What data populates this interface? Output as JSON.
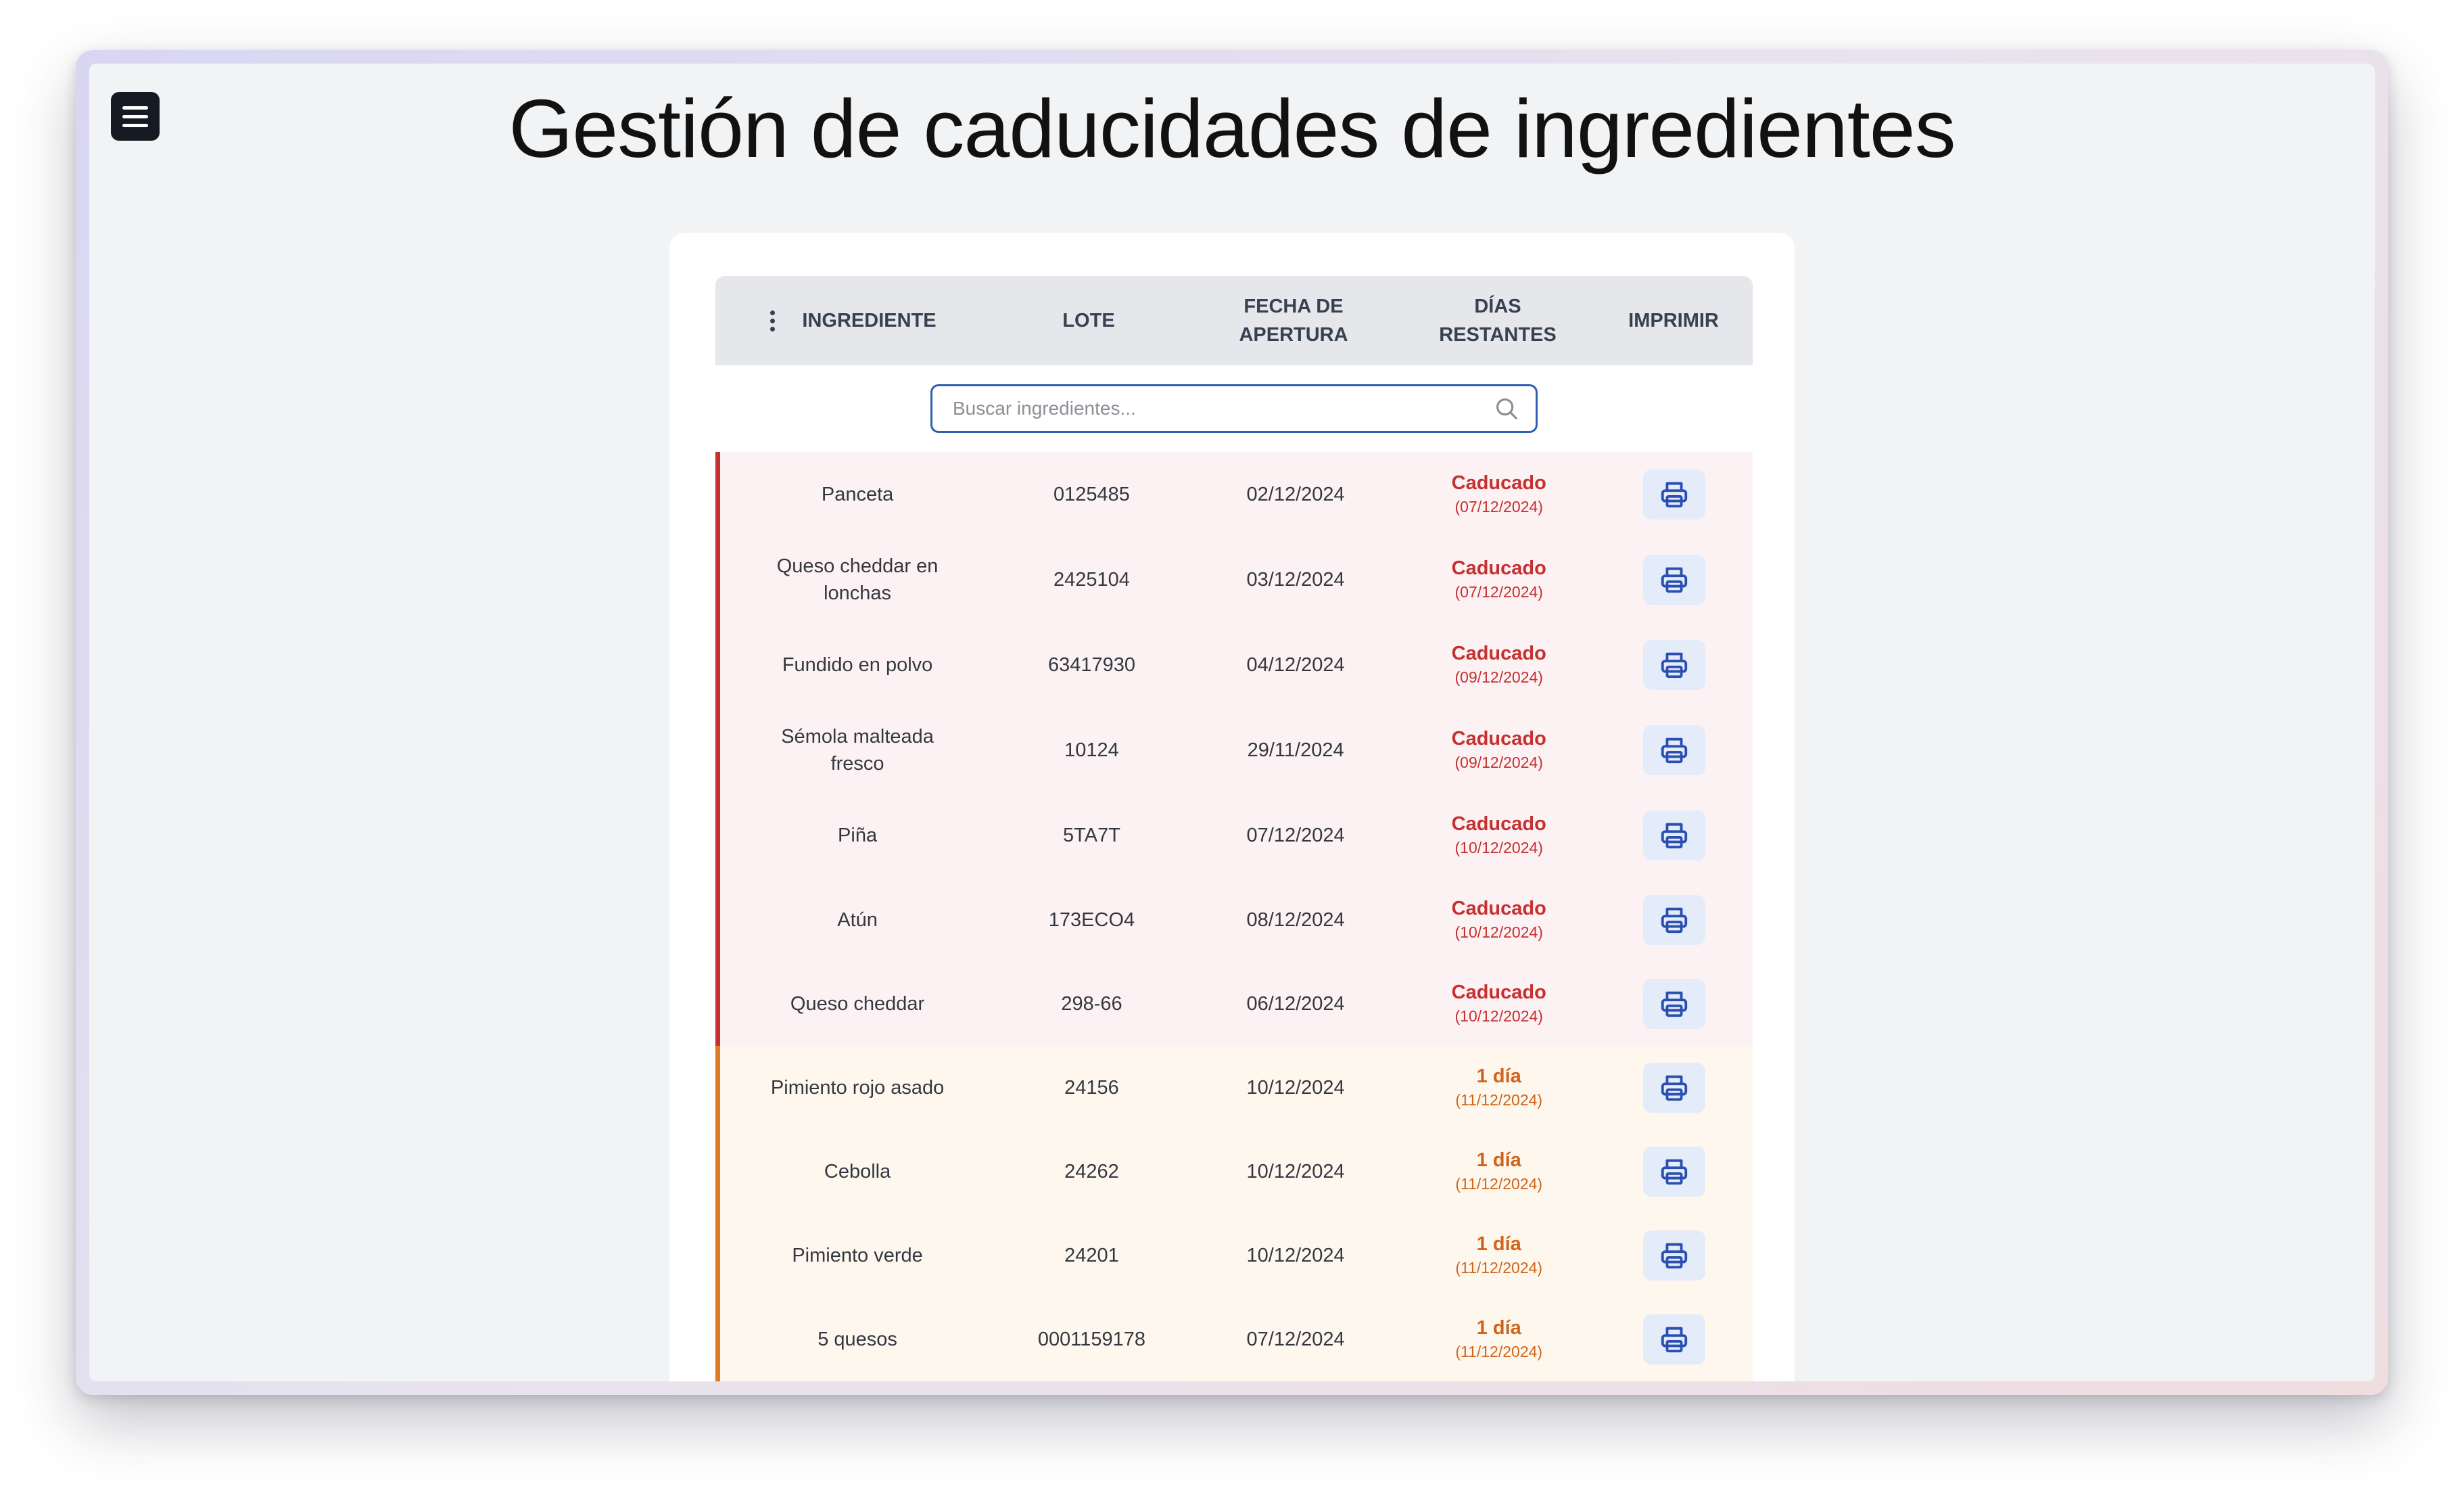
{
  "header": {
    "title": "Gestión de caducidades de ingredientes"
  },
  "table": {
    "columns": {
      "ingrediente": "INGREDIENTE",
      "lote": "LOTE",
      "fecha_l1": "FECHA DE",
      "fecha_l2": "APERTURA",
      "dias_l1": "DÍAS",
      "dias_l2": "RESTANTES",
      "imprimir": "IMPRIMIR"
    },
    "search": {
      "placeholder": "Buscar ingredientes...",
      "value": ""
    },
    "rows": [
      {
        "name_l1": "Panceta",
        "name_l2": "",
        "lote": "0125485",
        "fecha": "02/12/2024",
        "status": "Caducado",
        "date": "(07/12/2024)",
        "level": "expired"
      },
      {
        "name_l1": "Queso cheddar en",
        "name_l2": "lonchas",
        "lote": "2425104",
        "fecha": "03/12/2024",
        "status": "Caducado",
        "date": "(07/12/2024)",
        "level": "expired"
      },
      {
        "name_l1": "Fundido en polvo",
        "name_l2": "",
        "lote": "63417930",
        "fecha": "04/12/2024",
        "status": "Caducado",
        "date": "(09/12/2024)",
        "level": "expired"
      },
      {
        "name_l1": "Sémola malteada",
        "name_l2": "fresco",
        "lote": "10124",
        "fecha": "29/11/2024",
        "status": "Caducado",
        "date": "(09/12/2024)",
        "level": "expired"
      },
      {
        "name_l1": "Piña",
        "name_l2": "",
        "lote": "5TA7T",
        "fecha": "07/12/2024",
        "status": "Caducado",
        "date": "(10/12/2024)",
        "level": "expired"
      },
      {
        "name_l1": "Atún",
        "name_l2": "",
        "lote": "173ECO4",
        "fecha": "08/12/2024",
        "status": "Caducado",
        "date": "(10/12/2024)",
        "level": "expired"
      },
      {
        "name_l1": "Queso cheddar",
        "name_l2": "",
        "lote": "298-66",
        "fecha": "06/12/2024",
        "status": "Caducado",
        "date": "(10/12/2024)",
        "level": "expired"
      },
      {
        "name_l1": "Pimiento rojo asado",
        "name_l2": "",
        "lote": "24156",
        "fecha": "10/12/2024",
        "status": "1 día",
        "date": "(11/12/2024)",
        "level": "soon"
      },
      {
        "name_l1": "Cebolla",
        "name_l2": "",
        "lote": "24262",
        "fecha": "10/12/2024",
        "status": "1 día",
        "date": "(11/12/2024)",
        "level": "soon"
      },
      {
        "name_l1": "Pimiento verde",
        "name_l2": "",
        "lote": "24201",
        "fecha": "10/12/2024",
        "status": "1 día",
        "date": "(11/12/2024)",
        "level": "soon"
      },
      {
        "name_l1": "5 quesos",
        "name_l2": "",
        "lote": "0001159178",
        "fecha": "07/12/2024",
        "status": "1 día",
        "date": "(11/12/2024)",
        "level": "soon"
      }
    ]
  },
  "icons": {
    "menu": "menu-icon",
    "more": "more-vertical-icon",
    "search": "search-icon",
    "print": "printer-icon"
  },
  "colors": {
    "expired": "#c53030",
    "soon": "#e07a24",
    "accent": "#2f5fb3"
  }
}
